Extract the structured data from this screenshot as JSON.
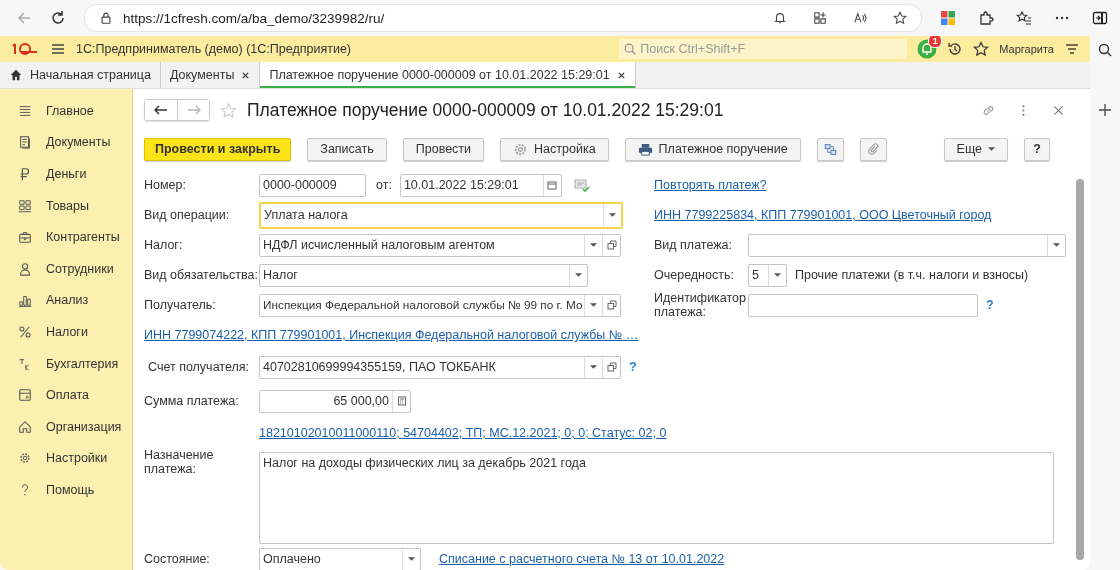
{
  "browser": {
    "url": "https://1cfresh.com/a/ba_demo/3239982/ru/"
  },
  "app": {
    "title": "1С:Предприниматель (демо)  (1С:Предприятие)",
    "search_placeholder": "Поиск Ctrl+Shift+F",
    "notifications": "1",
    "user": "Маргарита"
  },
  "tabs": [
    {
      "label": "Начальная страница",
      "kind": "home",
      "selected": false
    },
    {
      "label": "Документы",
      "kind": "closable",
      "selected": false
    },
    {
      "label": "Платежное поручение 0000-000009 от 10.01.2022 15:29:01",
      "kind": "closable",
      "selected": true
    }
  ],
  "sidebar": {
    "items": [
      {
        "label": "Главное",
        "kind": "lines"
      },
      {
        "label": "Документы",
        "kind": "document"
      },
      {
        "label": "Деньги",
        "kind": "ruble"
      },
      {
        "label": "Товары",
        "kind": "grid"
      },
      {
        "label": "Контрагенты",
        "kind": "briefcase"
      },
      {
        "label": "Сотрудники",
        "kind": "person"
      },
      {
        "label": "Анализ",
        "kind": "bars"
      },
      {
        "label": "Налоги",
        "kind": "percent"
      },
      {
        "label": "Бухгалтерия",
        "kind": "ledger"
      },
      {
        "label": "Оплата",
        "kind": "wallet"
      },
      {
        "label": "Организация",
        "kind": "house"
      },
      {
        "label": "Настройки",
        "kind": "gear"
      },
      {
        "label": "Помощь",
        "kind": "help"
      }
    ]
  },
  "form": {
    "title": "Платежное поручение 0000-000009 от 10.01.2022 15:29:01",
    "toolbar": [
      {
        "label": "Провести и закрыть",
        "kind": "primary"
      },
      {
        "label": "Записать",
        "kind": "plain"
      },
      {
        "label": "Провести",
        "kind": "plain"
      },
      {
        "label": "Настройка",
        "kind": "gear"
      },
      {
        "label": "Платежное поручение",
        "kind": "printer"
      },
      {
        "kind": "structure"
      },
      {
        "kind": "clip"
      }
    ],
    "more": "Еще",
    "help": "?",
    "number": {
      "label": "Номер:",
      "value": "0000-000009"
    },
    "date": {
      "label": "от:",
      "value": "10.01.2022 15:29:01"
    },
    "repeat_link": "Повторять платеж?",
    "operation": {
      "label": "Вид операции:",
      "value": "Уплата налога",
      "focused": true
    },
    "org_link": "ИНН 7799225834, КПП 779901001, ООО Цветочный город",
    "tax": {
      "label": "Налог:",
      "value": "НДФЛ исчисленный налоговым агентом"
    },
    "payment_type": {
      "label": "Вид платежа:"
    },
    "obligation": {
      "label": "Вид обязательства:",
      "value": "Налог"
    },
    "priority": {
      "label": "Очередность:",
      "value": "5",
      "description": "Прочие платежи (в т.ч. налоги и взносы)"
    },
    "recipient": {
      "label": "Получатель:",
      "value": "Инспекция Федеральной налоговой службы № 99 по г. Мо"
    },
    "payment_id": {
      "label": "Идентификатор платежа:",
      "help": "?"
    },
    "recipient_link": "ИНН 7799074222, КПП 779901001, Инспекция Федеральной налоговой службы № …",
    "account": {
      "label": "Счет получателя:",
      "value": "40702810699994355159, ПАО ТОКБАНК",
      "help": "?"
    },
    "amount": {
      "label": "Сумма платежа:",
      "value": "65 000,00"
    },
    "details_link": "18210102010011000110; 54704402; ТП; МС.12.2021; 0; 0; Статус: 02; 0",
    "purpose": {
      "label": "Назначение платежа:",
      "value": "Налог на доходы физических лиц за декабрь 2021 года"
    },
    "status": {
      "label": "Состояние:",
      "value": "Оплачено",
      "link": "Списание с расчетного счета № 13 от 10.01.2022"
    }
  }
}
